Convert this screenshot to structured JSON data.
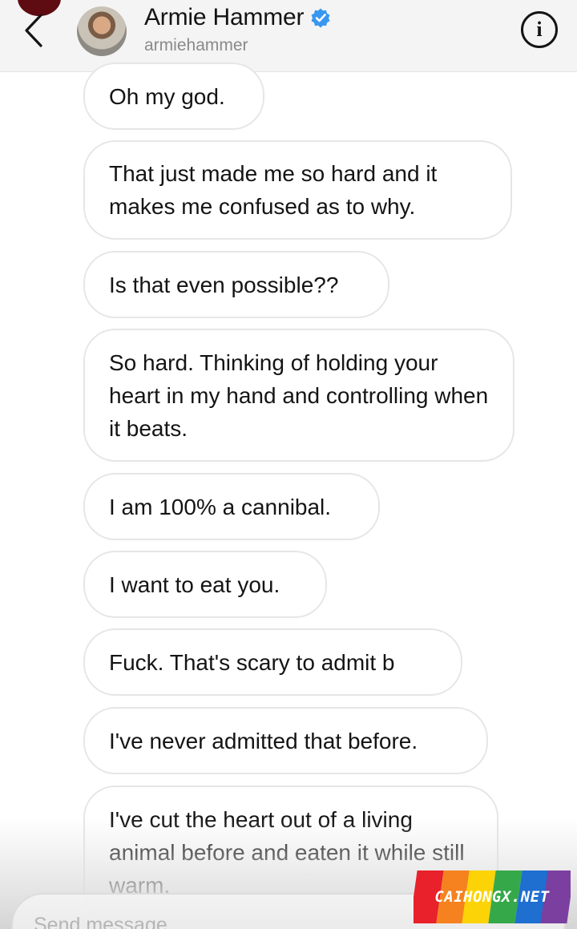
{
  "header": {
    "name": "Armie Hammer",
    "username": "armiehammer",
    "verified": true,
    "icons": {
      "back": "chevron-left-icon",
      "verified": "verified-badge-icon",
      "info": "info-icon"
    },
    "colors": {
      "verified": "#3897f0",
      "story_ring": "#5e0c12"
    }
  },
  "messages": [
    {
      "text": "Oh my god."
    },
    {
      "text": "That just made me so hard and it makes me confused as to why."
    },
    {
      "text": "Is that even possible??"
    },
    {
      "text": "So hard. Thinking of holding your heart in my hand and controlling when it beats."
    },
    {
      "text": "I am 100% a cannibal."
    },
    {
      "text": "I want to eat you."
    },
    {
      "text": "Fuck. That's scary to admit b"
    },
    {
      "text": "I've never admitted that before."
    },
    {
      "text": "I've cut the heart out of a living animal before and eaten it while still warm."
    }
  ],
  "composer": {
    "placeholder": "Send message..."
  },
  "watermark": {
    "text": "CAIHONGX.NET",
    "colors": [
      "#e8212a",
      "#f5821f",
      "#fcd307",
      "#35a94a",
      "#1f6fd1",
      "#7b3fa0"
    ]
  }
}
